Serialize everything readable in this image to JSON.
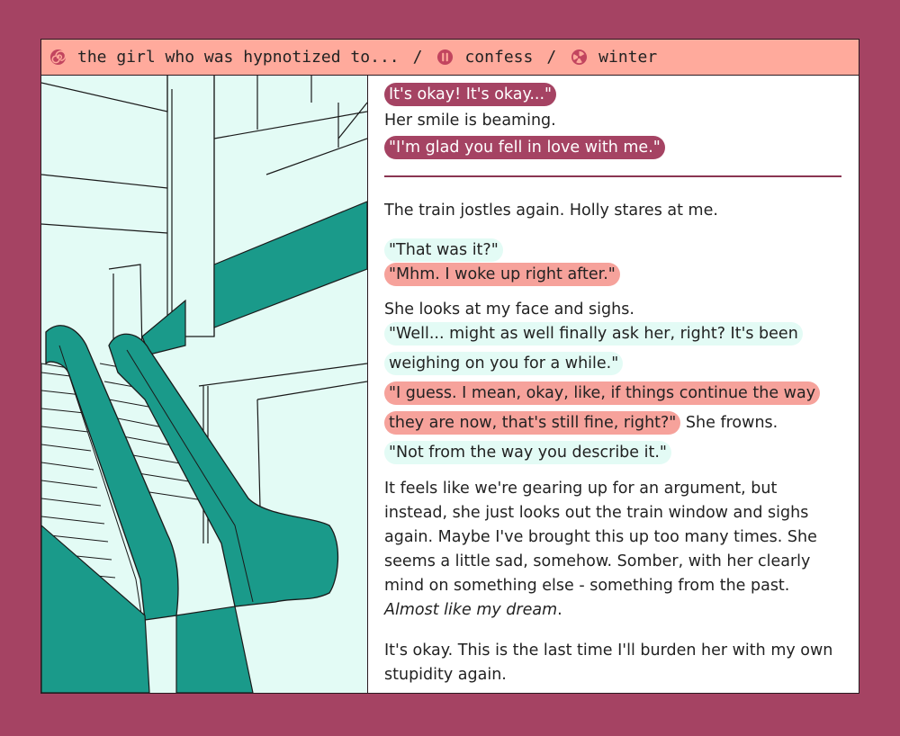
{
  "breadcrumb": {
    "items": [
      {
        "label": "the girl who was hypnotized to...",
        "icon": "spiral-icon"
      },
      {
        "label": "confess",
        "icon": "pause-icon"
      },
      {
        "label": "winter",
        "icon": "radiation-icon"
      }
    ],
    "separator": "/"
  },
  "colors": {
    "background": "#a54363",
    "titlebar": "#ffaa9c",
    "holly_pill": "#a54363",
    "me_pill": "#f6a29b",
    "mint_pill": "#e3fbf5",
    "escalator": "#1a9a8a"
  },
  "illustration": {
    "subject": "escalators"
  },
  "story": {
    "line1": "It's okay! It's okay...\"",
    "line2": "Her smile is beaming.",
    "line3": "\"I'm glad you fell in love with me.\"",
    "p1": "The train jostles again. Holly stares at me.",
    "d1": "\"That was it?\"",
    "d2": "\"Mhm. I woke up right after.\"",
    "p2": "She looks at my face and sighs.",
    "d3": "\"Well... might as well finally ask her, right? It's been weighing on you for a while.\"",
    "d4": "\"I guess. I mean, okay, like, if things continue the way they are now, that's still fine, right?\"",
    "d4_after": " She frowns.",
    "d5": "\"Not from the way you describe it.\"",
    "p3": "It feels like we're gearing up for an argument, but instead, she just looks out the train window and sighs again. Maybe I've brought this up too many times. She seems a little sad, somehow. Somber, with her clearly mind on something else - something from the past. ",
    "p3_em": "Almost like my dream",
    "p3_end": ".",
    "p4": "It's okay. This is the last time I'll burden her with my own stupidity again."
  }
}
